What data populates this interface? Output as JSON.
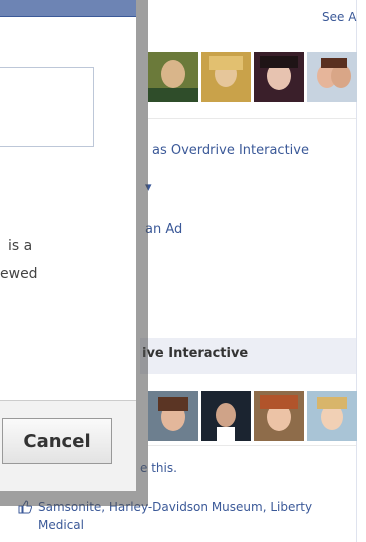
{
  "sidebar": {
    "see_all": "See A",
    "act_as": "as Overdrive Interactive",
    "create_ad": "an Ad",
    "header": "ive Interactive",
    "like_this": "e this.",
    "liked_pages": "Samsonite, Harley-Davidson Museum, Liberty Medical"
  },
  "dialog": {
    "partial_text_1": "is a",
    "partial_text_2": "ewed",
    "cancel_label": "Cancel"
  },
  "icons": [
    "thumbs-up-icon",
    "chevron-down-icon"
  ],
  "colors": {
    "accent": "#3b5998",
    "titlebar": "#6d84b4",
    "header_bar": "#eceef5"
  }
}
